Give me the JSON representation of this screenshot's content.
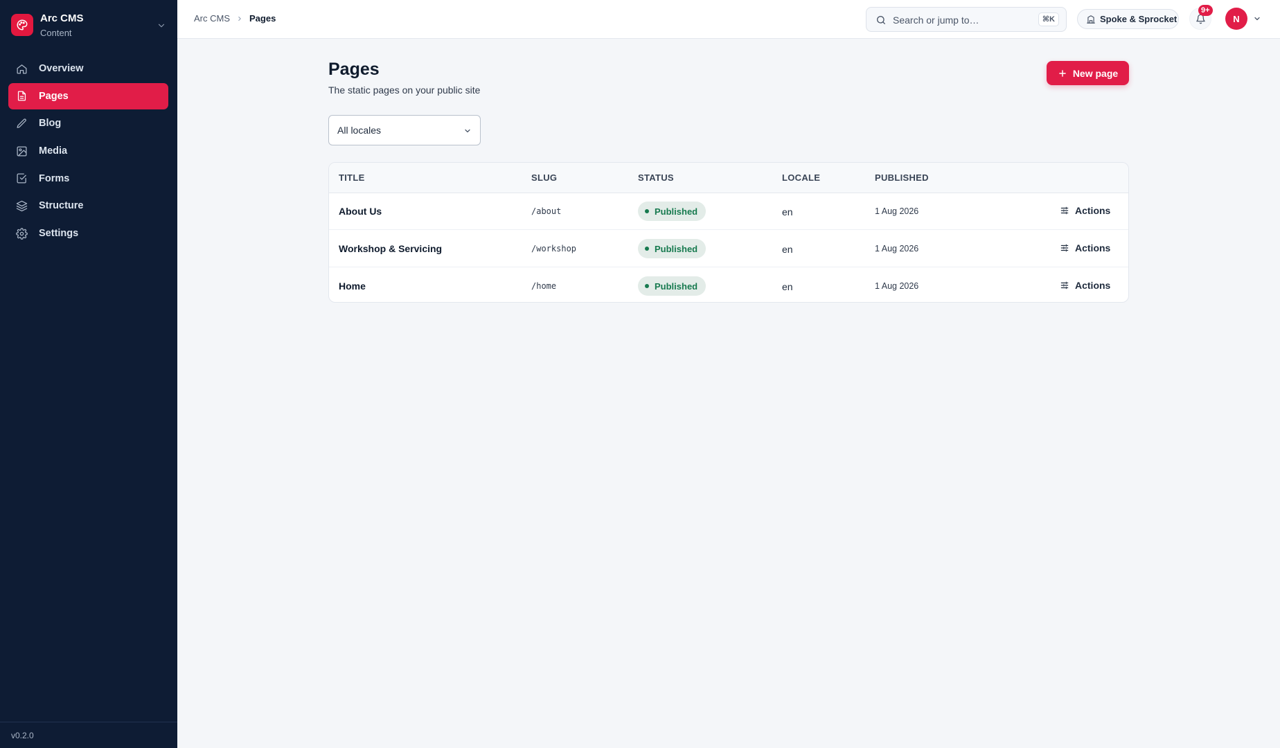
{
  "app": {
    "name": "Arc CMS",
    "section": "Content",
    "version": "v0.2.0"
  },
  "sidebar": {
    "items": [
      {
        "label": "Overview",
        "icon": "home-icon",
        "active": false
      },
      {
        "label": "Pages",
        "icon": "file-icon",
        "active": true
      },
      {
        "label": "Blog",
        "icon": "pencil-icon",
        "active": false
      },
      {
        "label": "Media",
        "icon": "image-icon",
        "active": false
      },
      {
        "label": "Forms",
        "icon": "checkbox-icon",
        "active": false
      },
      {
        "label": "Structure",
        "icon": "layers-icon",
        "active": false
      },
      {
        "label": "Settings",
        "icon": "gear-icon",
        "active": false
      }
    ]
  },
  "topbar": {
    "breadcrumb": [
      "Arc CMS",
      "Pages"
    ],
    "search_placeholder": "Search or jump to…",
    "search_shortcut": "⌘K",
    "site_name": "Spoke & Sprocket",
    "notifications_count": "9+",
    "user_initial": "N"
  },
  "main": {
    "title": "Pages",
    "subtitle": "The static pages on your public site",
    "new_button": "New page",
    "locale_filter": "All locales"
  },
  "table": {
    "columns": [
      "TITLE",
      "SLUG",
      "STATUS",
      "LOCALE",
      "PUBLISHED"
    ],
    "rows": [
      {
        "title": "About Us",
        "slug": "/about",
        "status": "Published",
        "locale": "en",
        "published": "1 Aug 2026",
        "action": "Actions"
      },
      {
        "title": "Workshop & Servicing",
        "slug": "/workshop",
        "status": "Published",
        "locale": "en",
        "published": "1 Aug 2026",
        "action": "Actions"
      },
      {
        "title": "Home",
        "slug": "/home",
        "status": "Published",
        "locale": "en",
        "published": "1 Aug 2026",
        "action": "Actions"
      }
    ]
  },
  "colors": {
    "sidebar_bg": "#0e1c34",
    "accent": "#e11d48",
    "status_green": "#177a4f",
    "page_bg": "#f4f6f9"
  }
}
